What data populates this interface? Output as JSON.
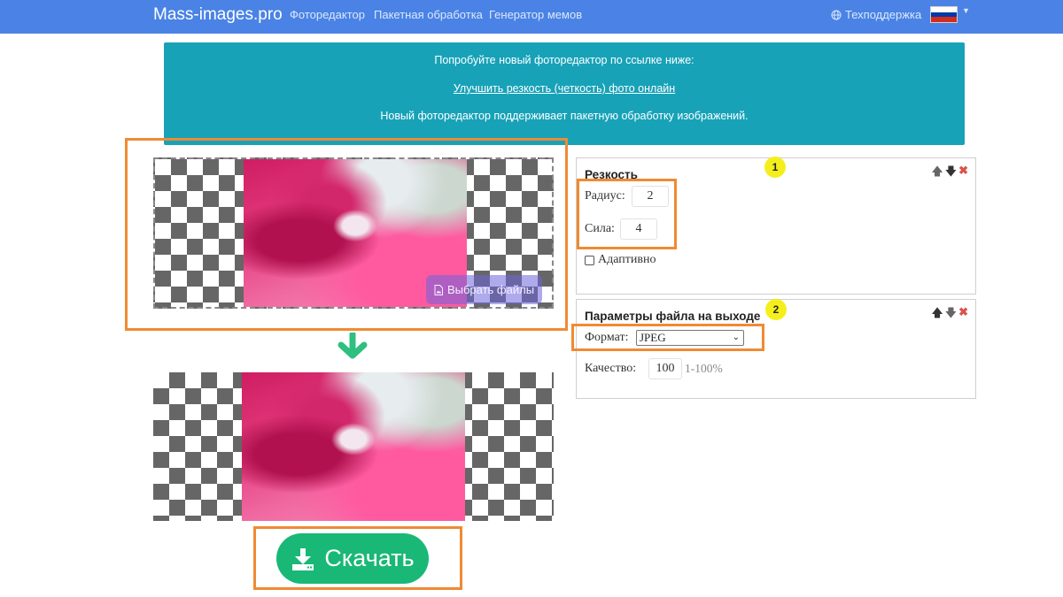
{
  "navbar": {
    "brand": "Mass-images.pro",
    "links": [
      "Фоторедактор",
      "Пакетная обработка",
      "Генератор мемов"
    ],
    "support": "Техподдержка",
    "language_flag_colors": [
      "#ffffff",
      "#0039a6",
      "#d52b1e"
    ]
  },
  "banner": {
    "line1": "Попробуйте новый фоторедактор по ссылке ниже:",
    "link": "Улучшить резкость (четкость) фото онлайн",
    "line3": "Новый фоторедактор поддерживает пакетную обработку изображений."
  },
  "upload": {
    "select_files_label": "Выбрать файлы"
  },
  "download": {
    "label": "Скачать"
  },
  "sharpness_panel": {
    "title": "Резкость",
    "badge": "1",
    "radius_label": "Радиус:",
    "radius_value": "2",
    "strength_label": "Сила:",
    "strength_value": "4",
    "adaptive_label": "Адаптивно",
    "adaptive_checked": false
  },
  "output_panel": {
    "title": "Параметры файла на выходе",
    "badge": "2",
    "format_label": "Формат:",
    "format_value": "JPEG",
    "quality_label": "Качество:",
    "quality_value": "100",
    "quality_hint": "1-100%"
  },
  "colors": {
    "navbar": "#4a83e5",
    "banner": "#17a2b8",
    "highlight": "#f08a33",
    "download_button": "#19b876",
    "badge": "#f4ef1c"
  }
}
